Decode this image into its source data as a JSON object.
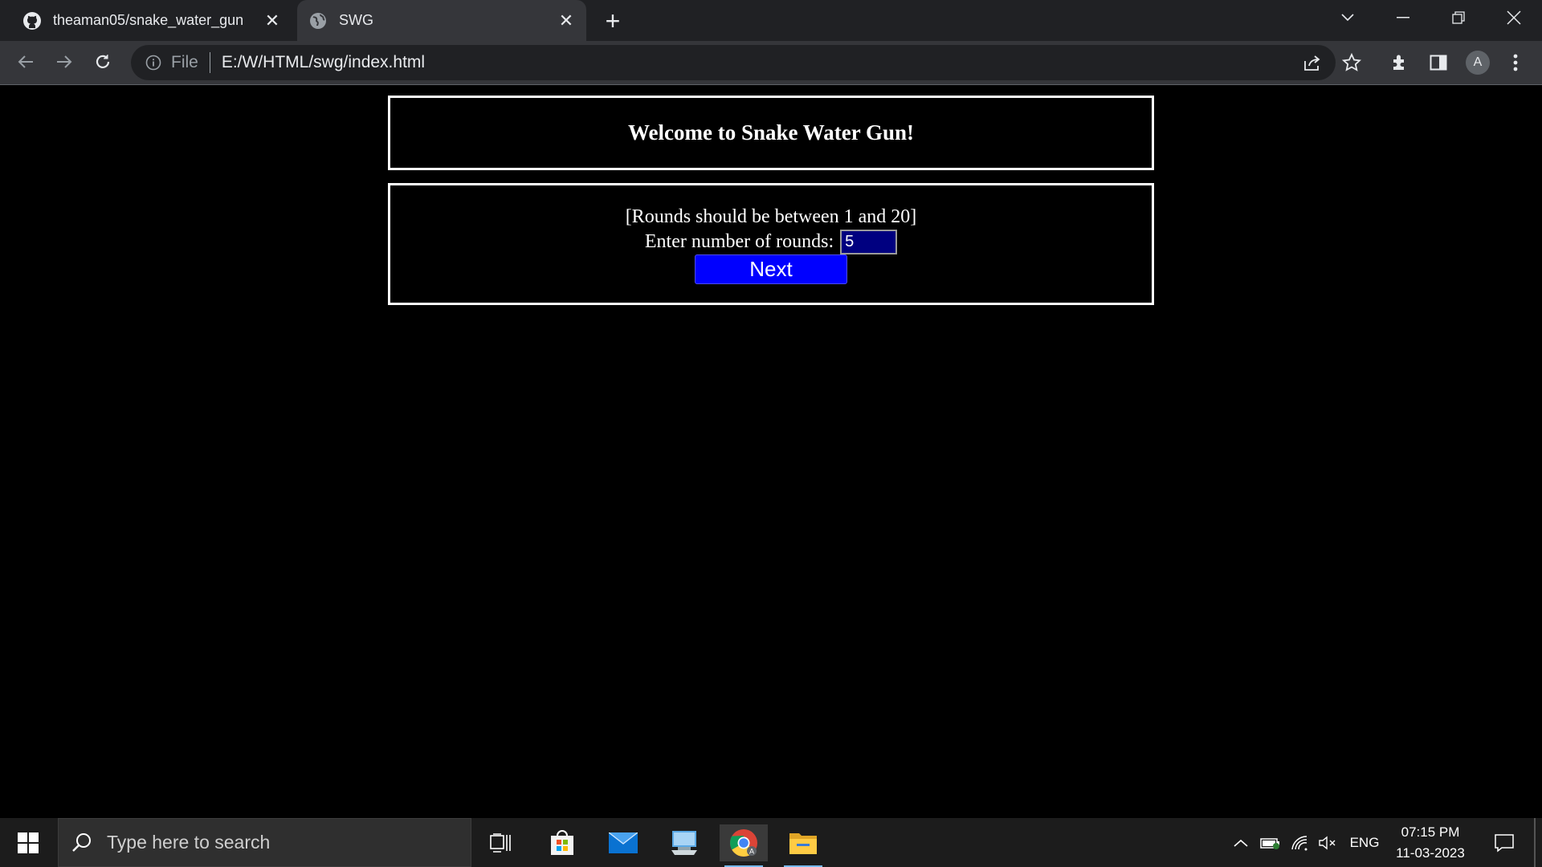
{
  "browser": {
    "tabs": [
      {
        "title": "theaman05/snake_water_gun",
        "favicon": "github-icon",
        "active": false
      },
      {
        "title": "SWG",
        "favicon": "globe-icon",
        "active": true
      }
    ],
    "address": {
      "scheme": "File",
      "url": "E:/W/HTML/swg/index.html"
    },
    "profile_initial": "A"
  },
  "page": {
    "heading": "Welcome to Snake Water Gun!",
    "hint": "[Rounds should be between 1 and 20]",
    "rounds_label": "Enter number of rounds:",
    "rounds_value": "5",
    "next_label": "Next"
  },
  "taskbar": {
    "search_placeholder": "Type here to search",
    "language": "ENG",
    "time": "07:15 PM",
    "date": "11-03-2023"
  },
  "colors": {
    "page_background": "#000000",
    "input_background": "#000080",
    "button_background": "#0000ff"
  }
}
